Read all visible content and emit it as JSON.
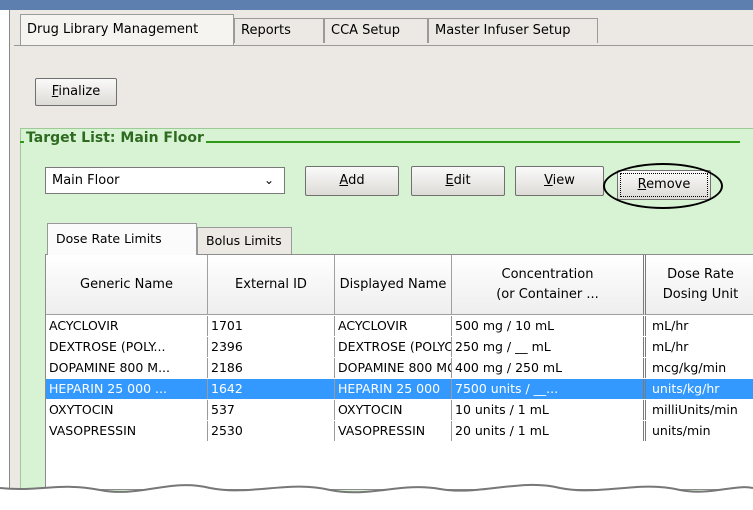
{
  "tabs": [
    "Drug Library Management",
    "Reports",
    "CCA Setup",
    "Master Infuser Setup"
  ],
  "finalize_label": "Finalize",
  "group_title": "Target List: Main Floor",
  "target_select": {
    "value": "Main Floor",
    "arrow": "⌄"
  },
  "actions": {
    "add": "Add",
    "edit": "Edit",
    "view": "View",
    "remove": "Remove"
  },
  "subtabs": [
    "Dose Rate Limits",
    "Bolus Limits"
  ],
  "columns": [
    "Generic Name",
    "External ID",
    "Displayed Name",
    "Concentration\n(or Container ...",
    "Dose Rate\nDosing Unit"
  ],
  "rows": [
    {
      "generic": "ACYCLOVIR",
      "ext_id": "1701",
      "displayed": "ACYCLOVIR",
      "concentration": "500 mg / 10 mL",
      "unit": "mL/hr"
    },
    {
      "generic": "DEXTROSE (POLY...",
      "ext_id": "2396",
      "displayed": "DEXTROSE (POLYO",
      "concentration": "250 mg / __ mL",
      "unit": "mL/hr"
    },
    {
      "generic": "DOPAMINE 800 M...",
      "ext_id": "2186",
      "displayed": "DOPAMINE 800 MG",
      "concentration": "400 mg / 250 mL",
      "unit": "mcg/kg/min"
    },
    {
      "generic": "HEPARIN 25 000 ...",
      "ext_id": "1642",
      "displayed": "HEPARIN 25 000",
      "concentration": "7500 units / __...",
      "unit": "units/kg/hr"
    },
    {
      "generic": "OXYTOCIN",
      "ext_id": "537",
      "displayed": "OXYTOCIN",
      "concentration": "10 units / 1 mL",
      "unit": "milliUnits/min"
    },
    {
      "generic": "VASOPRESSIN",
      "ext_id": "2530",
      "displayed": "VASOPRESSIN",
      "concentration": "20 units / 1 mL",
      "unit": "units/min"
    }
  ],
  "selected_row": 3,
  "colors": {
    "selection": "#3399ff",
    "group_bg": "#d8f3d4",
    "group_title": "#2e6b21"
  }
}
